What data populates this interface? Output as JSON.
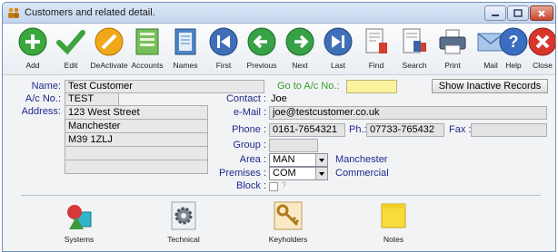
{
  "window": {
    "title": "Customers and related detail."
  },
  "toolbar": [
    {
      "label": "Add",
      "icon": "add-icon"
    },
    {
      "label": "Edit",
      "icon": "checkmark-icon"
    },
    {
      "label": "DeActivate",
      "icon": "deactivate-icon"
    },
    {
      "label": "Accounts",
      "icon": "ledger-icon"
    },
    {
      "label": "Names",
      "icon": "notebook-icon"
    },
    {
      "label": "First",
      "icon": "first-record-icon"
    },
    {
      "label": "Previous",
      "icon": "previous-record-icon"
    },
    {
      "label": "Next",
      "icon": "next-record-icon"
    },
    {
      "label": "Last",
      "icon": "last-record-icon"
    },
    {
      "label": "Find",
      "icon": "find-icon"
    },
    {
      "label": "Search",
      "icon": "search-icon"
    },
    {
      "label": "Print",
      "icon": "printer-icon"
    },
    {
      "label": "Mail",
      "icon": "envelope-icon"
    },
    {
      "label": "Help",
      "icon": "help-icon"
    },
    {
      "label": "Close",
      "icon": "close-icon"
    }
  ],
  "form": {
    "name_label": "Name:",
    "name_value": "Test Customer",
    "acno_label": "A/c No.:",
    "acno_value": "TEST",
    "address_label": "Address:",
    "address_lines": [
      "123 West Street",
      "Manchester",
      "M39 1ZLJ",
      "",
      ""
    ],
    "goto_label": "Go to A/c No.:",
    "goto_value": "",
    "show_inactive_label": "Show Inactive Records",
    "contact_label": "Contact :",
    "contact_value": "Joe",
    "email_label": "e-Mail :",
    "email_value": "joe@testcustomer.co.uk",
    "phone_label": "Phone :",
    "phone_value": "0161-7654321",
    "ph_label": "Ph.:",
    "ph_value": "07733-765432",
    "fax_label": "Fax :",
    "fax_value": "",
    "group_label": "Group :",
    "group_value": "",
    "area_label": "Area :",
    "area_code": "MAN",
    "area_name": "Manchester",
    "premises_label": "Premises :",
    "premises_code": "COM",
    "premises_name": "Commercial",
    "block_label": "Block :",
    "block_hint": "?"
  },
  "bottom": [
    {
      "label": "Systems",
      "icon": "systems-shapes-icon"
    },
    {
      "label": "Technical",
      "icon": "gear-icon"
    },
    {
      "label": "Keyholders",
      "icon": "keys-icon"
    },
    {
      "label": "Notes",
      "icon": "sticky-note-icon"
    }
  ],
  "colors": {
    "accent_label": "#1e2a8a",
    "goto_label": "#3b9c2b",
    "field_yellow": "#fbf29e"
  }
}
